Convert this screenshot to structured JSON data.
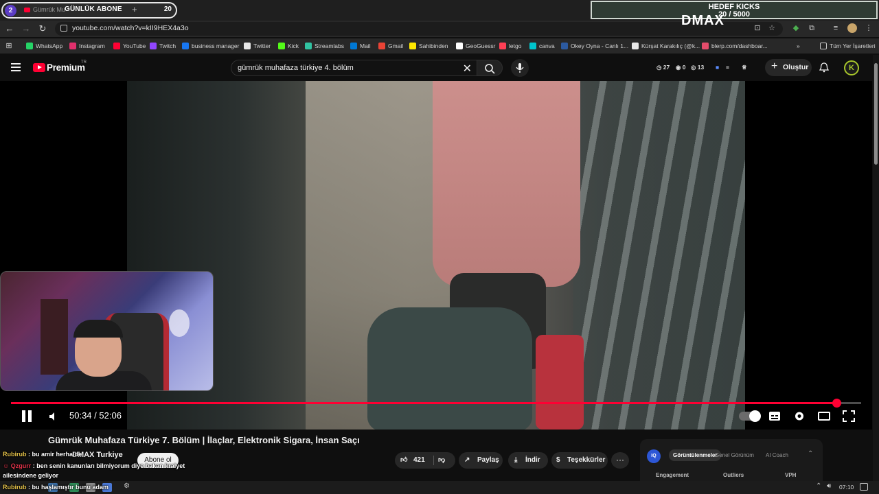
{
  "browser": {
    "tab_count": "2",
    "tab_title": "Gümrük Mu",
    "new_tab": "+",
    "url": "youtube.com/watch?v=kII9HEX4a3o",
    "overlay_subs": {
      "label": "GÜNLÜK ABONE",
      "count": "20"
    },
    "goal": {
      "title": "HEDEF KICKS",
      "progress": "20 / 5000"
    },
    "bookmarks": [
      {
        "label": "WhatsApp",
        "color": "#25d366"
      },
      {
        "label": "Instagram",
        "color": "#e1306c"
      },
      {
        "label": "YouTube",
        "color": "#ff0033"
      },
      {
        "label": "Twitch",
        "color": "#9146ff"
      },
      {
        "label": "business manager",
        "color": "#1877f2"
      },
      {
        "label": "Twitter",
        "color": "#e7e7e7"
      },
      {
        "label": "Kick",
        "color": "#53fc18"
      },
      {
        "label": "Streamlabs",
        "color": "#31c3a2"
      },
      {
        "label": "Mail",
        "color": "#0078d4"
      },
      {
        "label": "Gmail",
        "color": "#ea4335"
      },
      {
        "label": "Sahibinden",
        "color": "#ffe800"
      },
      {
        "label": "GeoGuessr",
        "color": "#ffffff"
      },
      {
        "label": "letgo",
        "color": "#ff3f55"
      },
      {
        "label": "canva",
        "color": "#00c4cc"
      },
      {
        "label": "Okey Oyna - Canlı 1...",
        "color": "#2c5aa0"
      },
      {
        "label": "Kürşat Karakılıç (@k...",
        "color": "#e7e7e7"
      },
      {
        "label": "blerp.com/dashboar...",
        "color": "#e44c6b"
      }
    ],
    "all_bookmarks": "Tüm Yer İşaretleri"
  },
  "youtube": {
    "brand": "Premium",
    "region": "TR",
    "search_query": "gümrük muhafaza türkiye 4. bölüm",
    "stats": {
      "a": "27",
      "b": "0",
      "c": "13"
    },
    "create_label": "Oluştur",
    "avatar_letter": "K"
  },
  "video": {
    "channel_watermark": "DMAX",
    "current_time": "50:34",
    "duration": "52:06",
    "progress_fraction": 0.971,
    "title": "Gümrük Muhafaza Türkiye 7. Bölüm | İlaçlar, Elektronik Sigara, İnsan Saçı",
    "channel": "DMAX Turkiye",
    "subscribe": "Abone ol",
    "likes": "421",
    "share": "Paylaş",
    "download": "İndir",
    "thanks": "Teşekkürler",
    "more": "···"
  },
  "iq": {
    "logo": "IQ",
    "tabs": [
      "Görüntülenmeler",
      "Genel Görünüm",
      "AI Coach"
    ],
    "columns": [
      "Engagement",
      "Outliers",
      "VPH"
    ]
  },
  "chat": [
    {
      "user": "Rubirub",
      "text": " : bu amir herhalde"
    },
    {
      "user": "Qzgurr",
      "text": " : ben senin kanunları bilmiyorum diye bakan kralyet"
    },
    {
      "user": "",
      "text": "ailesindene geliyor"
    },
    {
      "user": "Rubirub",
      "text": " : bu haşlamıştır bunu adam"
    }
  ],
  "taskbar": {
    "clock": "07:10"
  }
}
